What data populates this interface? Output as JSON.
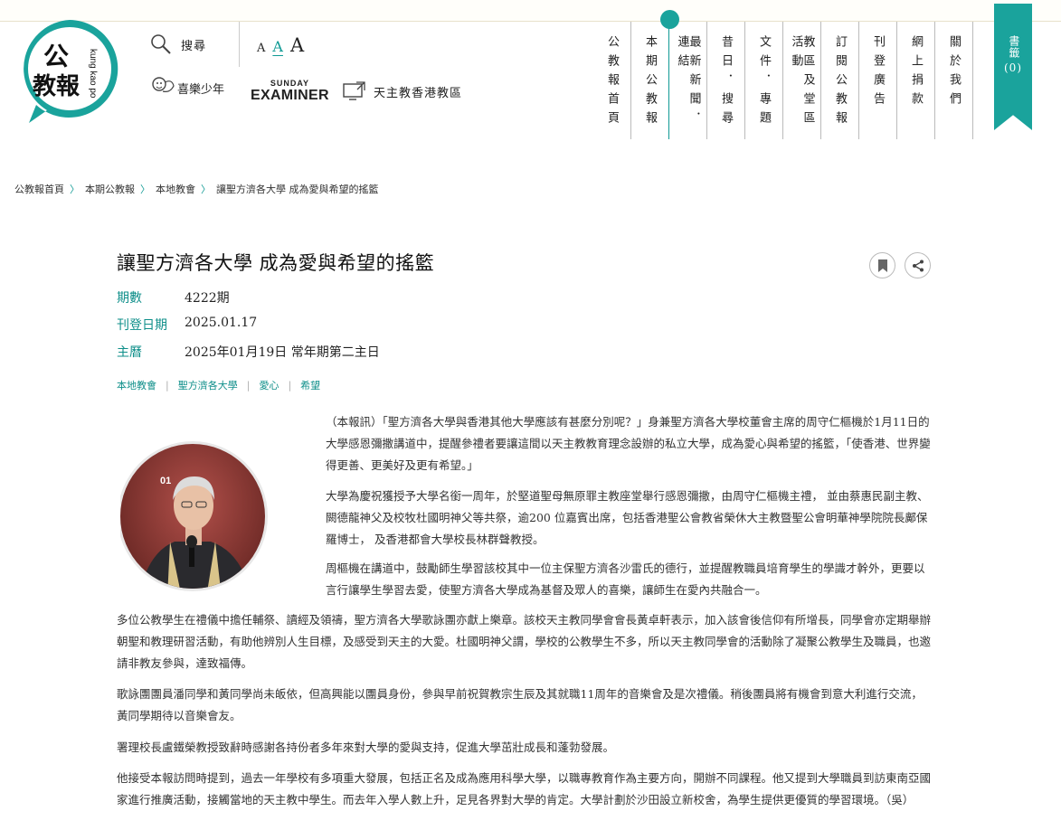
{
  "header": {
    "logo_text": "公教報",
    "logo_latin": "kung kao po",
    "search_label": "搜尋",
    "font_sizes": [
      "A",
      "A",
      "A"
    ],
    "joyteen_label": "喜樂少年",
    "examiner_top": "SUNDAY",
    "examiner_main": "EXAMINER",
    "diocese_label": "天主教香港教區"
  },
  "nav": {
    "items": [
      {
        "label": "公教報首頁"
      },
      {
        "label": "本期公教報"
      },
      {
        "label": "最新新聞．連結"
      },
      {
        "label": "昔日．搜尋"
      },
      {
        "label": "文件．專題"
      },
      {
        "label": "教區及堂區活動"
      },
      {
        "label": "訂閱公教報"
      },
      {
        "label": "刊登廣告"
      },
      {
        "label": "網上捐款"
      },
      {
        "label": "關於我們"
      }
    ],
    "active_index": 1
  },
  "bookmark_tab": {
    "label": "書籤",
    "count": "(0)"
  },
  "breadcrumb": [
    "公教報首頁",
    "本期公教報",
    "本地教會",
    "讓聖方濟各大學 成為愛與希望的搖籃"
  ],
  "article": {
    "title": "讓聖方濟各大學 成為愛與希望的搖籃",
    "meta": [
      {
        "key": "期數",
        "value": "4222期"
      },
      {
        "key": "刊登日期",
        "value": "2025.01.17"
      },
      {
        "key": "主曆",
        "value": "2025年01月19日 常年期第二主日"
      }
    ],
    "tags": [
      "本地教會",
      "聖方濟各大學",
      "愛心",
      "希望"
    ],
    "photo_label": "01",
    "paragraphs": [
      "（本報訊）「聖方濟各大學與香港其他大學應該有甚麼分別呢？」身兼聖方濟各大學校董會主席的周守仁樞機於1月11日的大學感恩彌撒講道中，提醒參禮者要讓這間以天主教教育理念設辦的私立大學，成為愛心與希望的搖籃，「使香港、世界變得更善、更美好及更有希望。」",
      "大學為慶祝獲授予大學名銜一周年，於堅道聖母無原罪主教座堂舉行感恩彌撒，由周守仁樞機主禮， 並由蔡惠民副主教、闕德龍神父及校牧杜國明神父等共祭，逾200 位嘉賓出席，包括香港聖公會教省榮休大主教暨聖公會明華神學院院長鄺保羅博士， 及香港都會大學校長林群聲教授。",
      "周樞機在講道中，鼓勵師生學習該校其中一位主保聖方濟各沙雷氏的德行，並提醒教職員培育學生的學識才幹外，更要以言行讓學生學習去愛，使聖方濟各大學成為基督及眾人的喜樂，讓師生在愛內共融合一。",
      "多位公教學生在禮儀中擔任輔祭、讀經及領禱，聖方濟各大學歌詠團亦獻上樂章。該校天主教同學會會長黃卓軒表示，加入該會後信仰有所增長，同學會亦定期舉辦朝聖和教理研習活動，有助他辨別人生目標，及感受到天主的大愛。杜國明神父謂，學校的公教學生不多，所以天主教同學會的活動除了凝聚公教學生及職員，也邀請非教友參與，達致福傳。",
      "歌詠團團員潘同學和黃同學尚未皈依，但高興能以團員身份，參與早前祝賀教宗生辰及其就職11周年的音樂會及是次禮儀。稍後團員將有機會到意大利進行交流，黃同學期待以音樂會友。",
      "署理校長盧鐵榮教授致辭時感謝各持份者多年來對大學的愛與支持，促進大學茁壯成長和蓬勃發展。",
      "他接受本報訪問時提到，過去一年學校有多項重大發展，包括正名及成為應用科學大學，以職專教育作為主要方向，開辦不同課程。他又提到大學職員到訪東南亞國家進行推廣活動，接觸當地的天主教中學生。而去年入學人數上升，足見各界對大學的肯定。大學計劃於沙田設立新校舍，為學生提供更優質的學習環境。（吳）"
    ]
  },
  "colors": {
    "accent": "#1aa39c",
    "accent_text": "#0f8f8a"
  }
}
